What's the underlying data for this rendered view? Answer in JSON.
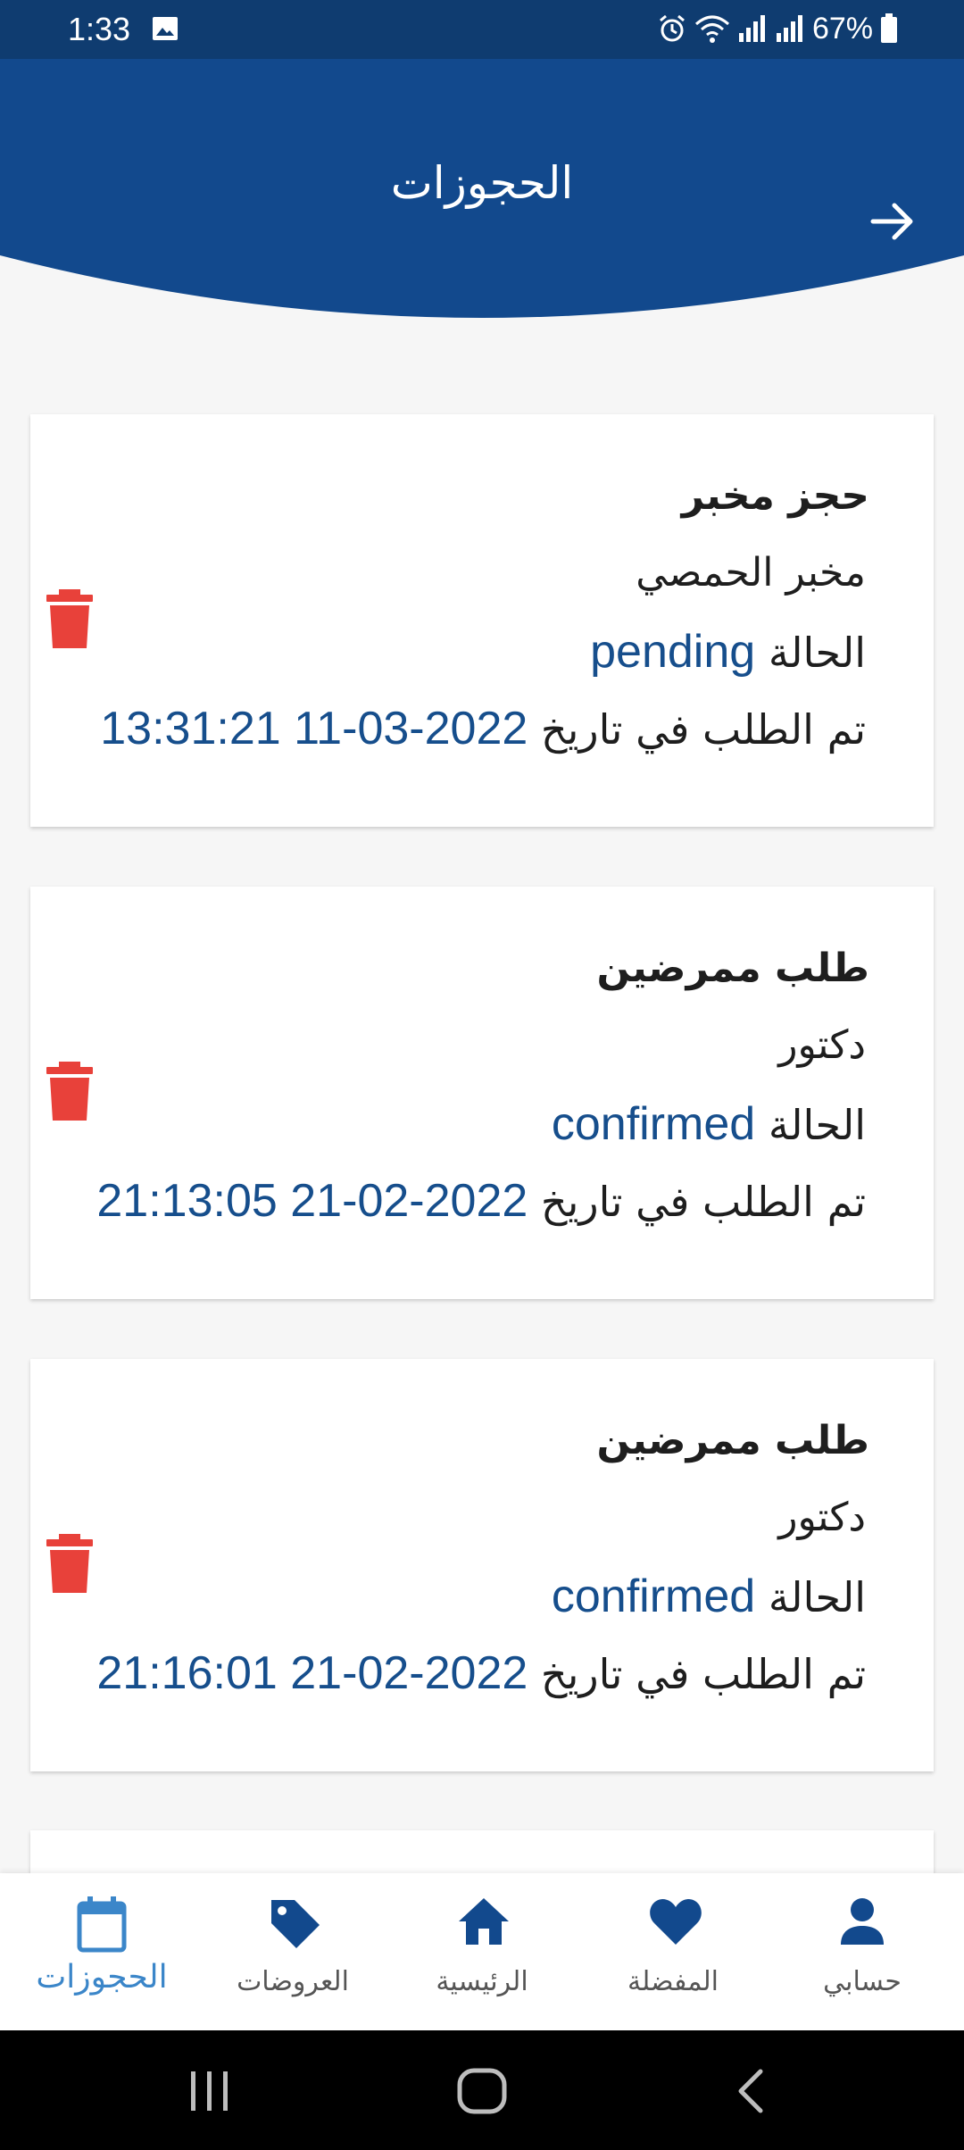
{
  "status_bar": {
    "time": "1:33",
    "battery": "67%"
  },
  "header": {
    "title": "الحجوزات"
  },
  "bookings": [
    {
      "title": "حجز مخبر",
      "subtitle": "مخبر الحمصي",
      "status_label": "الحالة",
      "status_value": "pending",
      "date_label": "تم الطلب في تاريخ",
      "date_value": "2022-03-11 13:31:21"
    },
    {
      "title": "طلب ممرضين",
      "subtitle": "دكتور",
      "status_label": "الحالة",
      "status_value": "confirmed",
      "date_label": "تم الطلب في تاريخ",
      "date_value": "2022-02-21 21:13:05"
    },
    {
      "title": "طلب ممرضين",
      "subtitle": "دكتور",
      "status_label": "الحالة",
      "status_value": "confirmed",
      "date_label": "تم الطلب في تاريخ",
      "date_value": "2022-02-21 21:16:01"
    }
  ],
  "bottom_nav": {
    "items": [
      {
        "label": "الحجوزات",
        "icon": "calendar-icon",
        "active": true
      },
      {
        "label": "العروضات",
        "icon": "tag-icon",
        "active": false
      },
      {
        "label": "الرئيسية",
        "icon": "home-icon",
        "active": false
      },
      {
        "label": "المفضلة",
        "icon": "heart-icon",
        "active": false
      },
      {
        "label": "حسابي",
        "icon": "person-icon",
        "active": false
      }
    ]
  },
  "colors": {
    "primary": "#12498d",
    "status_bar": "#0f3c70",
    "accent_value": "#164e8c",
    "active_nav": "#3b86c9",
    "delete": "#e8413a"
  }
}
